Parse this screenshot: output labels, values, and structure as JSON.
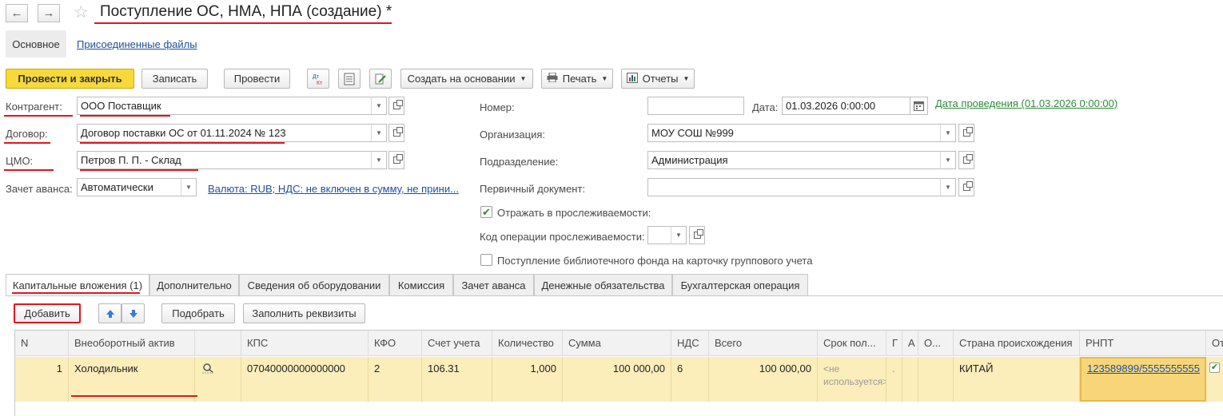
{
  "window": {
    "title": "Поступление ОС, НМА, НПА (создание) *"
  },
  "form_tabs": {
    "main": "Основное",
    "files": "Присоединенные файлы"
  },
  "toolbar": {
    "post_close": "Провести и закрыть",
    "save": "Записать",
    "post": "Провести",
    "create_based_on": "Создать на основании",
    "print": "Печать",
    "reports": "Отчеты"
  },
  "fields": {
    "counterparty_label": "Контрагент:",
    "counterparty_value": "ООО Поставщик",
    "contract_label": "Договор:",
    "contract_value": "Договор поставки ОС от 01.11.2024 № 123",
    "cmo_label": "ЦМО:",
    "cmo_value": "Петров П. П. - Склад",
    "advance_label": "Зачет аванса:",
    "advance_value": "Автоматически",
    "currency_link": "Валюта: RUB; НДС: не включен в сумму, не прини...",
    "number_label": "Номер:",
    "number_value": "",
    "date_label": "Дата:",
    "date_value": "01.03.2026  0:00:00",
    "posting_date_link": "Дата проведения (01.03.2026 0:00:00)",
    "org_label": "Организация:",
    "org_value": "МОУ СОШ №999",
    "division_label": "Подразделение:",
    "division_value": "Администрация",
    "primary_doc_label": "Первичный документ:",
    "primary_doc_value": "",
    "traceability_label": "Отражать в прослеживаемости:",
    "traceability_checked": true,
    "trace_code_label": "Код операции прослеживаемости:",
    "trace_code_value": "",
    "library_label": "Поступление библиотечного фонда на карточку группового учета",
    "library_checked": false
  },
  "tabs": [
    "Капитальные вложения (1)",
    "Дополнительно",
    "Сведения об оборудовании",
    "Комиссия",
    "Зачет аванса",
    "Денежные обязательства",
    "Бухгалтерская операция"
  ],
  "table_toolbar": {
    "add": "Добавить",
    "pick": "Подобрать",
    "fill": "Заполнить реквизиты"
  },
  "table": {
    "headers": [
      "N",
      "Внеоборотный актив",
      "",
      "КПС",
      "КФО",
      "Счет учета",
      "Количество",
      "Сумма",
      "НДС",
      "Всего",
      "Срок пол...",
      "Г",
      "А",
      "О...",
      "Страна происхождения",
      "РНПТ",
      "От"
    ],
    "row": {
      "n": "1",
      "asset": "Холодильник",
      "kps": "07040000000000000",
      "kfo": "2",
      "account": "106.31",
      "qty": "1,000",
      "sum": "100 000,00",
      "vat": "6",
      "total": "100 000,00",
      "term": "<не используется>",
      "g": ".",
      "country": "КИТАЙ",
      "rnpt": "123589899/5555555555",
      "ot_checked": true
    }
  },
  "colors": {
    "accent_red": "#e0161d",
    "primary_button": "#f7d93c",
    "row_highlight": "#fbeebb",
    "link": "#1d4f9c",
    "green_link": "#2e8b3a"
  }
}
